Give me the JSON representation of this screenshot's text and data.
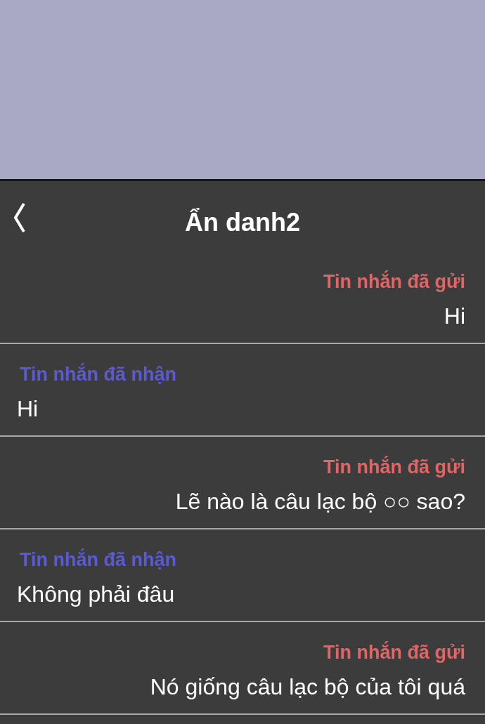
{
  "header": {
    "title": "Ẩn danh2"
  },
  "messages": [
    {
      "kind": "sent",
      "label": "Tin nhắn đã gửi",
      "text": "Hi"
    },
    {
      "kind": "received",
      "label": "Tin nhắn đã nhận",
      "text": "Hi"
    },
    {
      "kind": "sent",
      "label": "Tin nhắn đã gửi",
      "text": "Lẽ nào là câu lạc bộ ○○ sao?"
    },
    {
      "kind": "received",
      "label": "Tin nhắn đã nhận",
      "text": "Không phải đâu"
    },
    {
      "kind": "sent",
      "label": "Tin nhắn đã gửi",
      "text": "Nó giống câu lạc bộ của tôi quá"
    }
  ]
}
